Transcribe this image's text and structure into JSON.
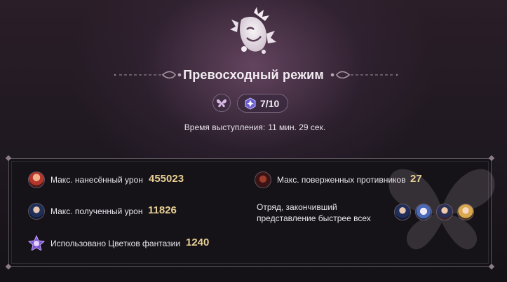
{
  "header": {
    "title": "Превосходный режим",
    "emblem_icon": "theater-mask-emblem-icon",
    "mode_icon": "butterfly-icon",
    "progress_icon": "hexagon-star-icon",
    "progress": "7/10",
    "duration_label": "Время выступления:",
    "duration_value": "11 мин. 29 сек."
  },
  "stats": {
    "max_damage_dealt": {
      "label": "Макс. нанесённый урон",
      "value": "455023"
    },
    "max_damage_taken": {
      "label": "Макс. полученный урон",
      "value": "11826"
    },
    "fantasia_flowers": {
      "label": "Использовано Цветков фантазии",
      "value": "1240"
    },
    "max_enemies_defeated": {
      "label": "Макс. поверженных противников",
      "value": "27"
    },
    "fastest_team": {
      "label": "Отряд, закончивший представление быстрее всех"
    }
  },
  "colors": {
    "accent_value": "#e8cf95",
    "panel_border": "#5a5058"
  }
}
